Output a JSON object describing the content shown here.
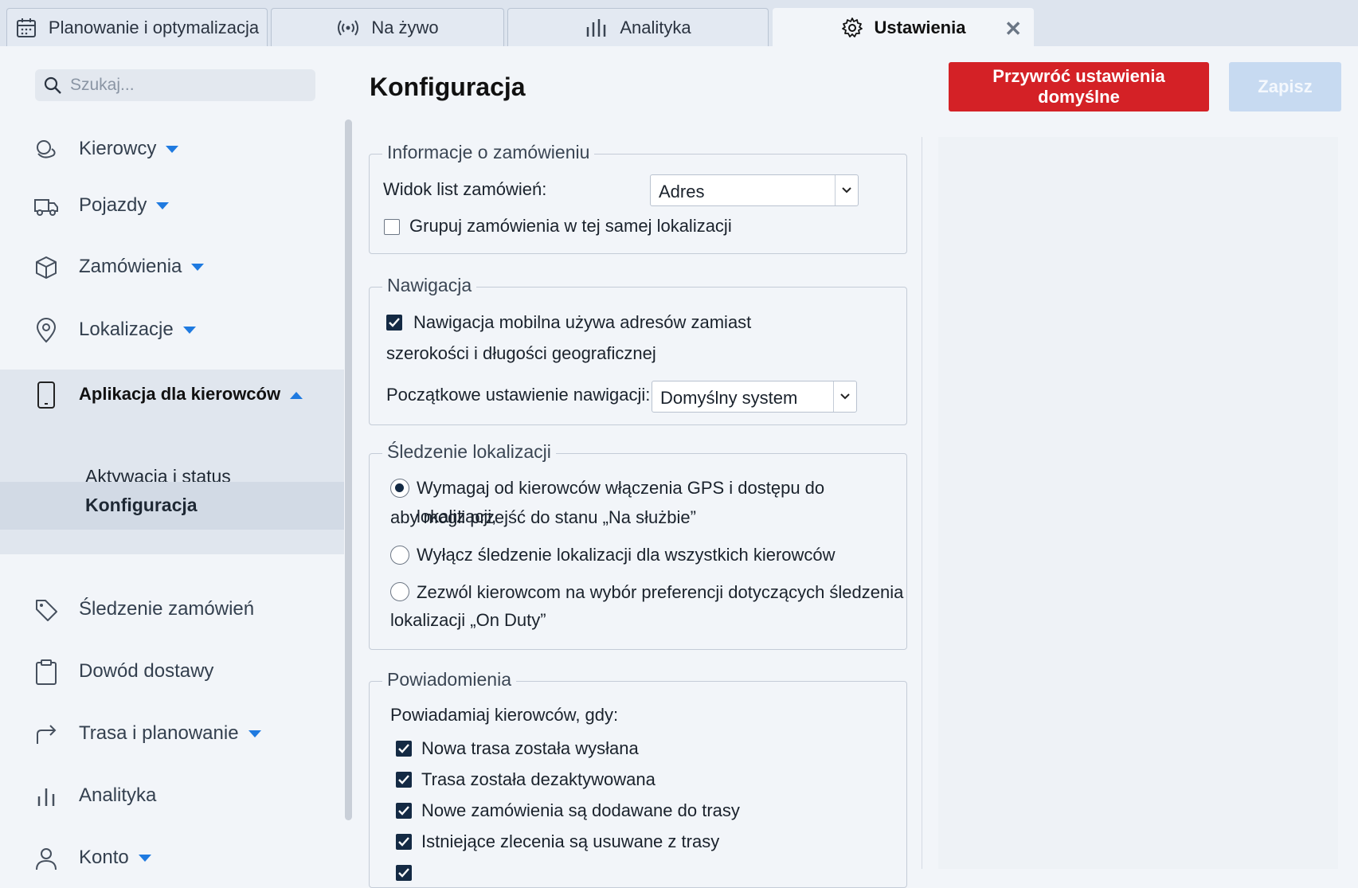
{
  "tabs": [
    {
      "label": "Planowanie i optymalizacja",
      "icon": "calendar-icon"
    },
    {
      "label": "Na żywo",
      "icon": "broadcast-icon"
    },
    {
      "label": "Analityka",
      "icon": "bar-chart-icon"
    },
    {
      "label": "Ustawienia",
      "icon": "gear-icon",
      "active": true
    }
  ],
  "search": {
    "placeholder": "Szukaj..."
  },
  "sidebar": {
    "items": [
      {
        "label": "Kierowcy",
        "icon": "drivers-icon"
      },
      {
        "label": "Pojazdy",
        "icon": "truck-icon"
      },
      {
        "label": "Zamówienia",
        "icon": "package-icon"
      },
      {
        "label": "Lokalizacje",
        "icon": "map-pin-icon"
      },
      {
        "label": "Aplikacja dla kierowców",
        "icon": "phone-icon",
        "expanded": true
      },
      {
        "label": "Śledzenie zamówień",
        "icon": "tag-icon"
      },
      {
        "label": "Dowód dostawy",
        "icon": "clipboard-icon"
      },
      {
        "label": "Trasa i planowanie",
        "icon": "route-arrow-icon"
      },
      {
        "label": "Analityka",
        "icon": "bar-chart-icon"
      },
      {
        "label": "Konto",
        "icon": "user-icon"
      }
    ],
    "subitems": [
      {
        "label": "Aktywacja i status"
      },
      {
        "label": "Konfiguracja",
        "selected": true
      }
    ]
  },
  "header": {
    "title": "Konfiguracja",
    "reset_label": "Przywróć ustawienia domyślne",
    "save_label": "Zapisz"
  },
  "colors": {
    "accent": "#1f7ae0",
    "danger": "#d42126",
    "save_disabled": "#c7daf1",
    "check": "#142a44"
  },
  "order_info": {
    "legend": "Informacje o zamówieniu",
    "list_view_label": "Widok list zamówień:",
    "list_view_value": "Adres",
    "group_label": "Grupuj zamówienia w tej samej lokalizacji",
    "group_checked": false
  },
  "navigation": {
    "legend": "Nawigacja",
    "use_address_label_1": "Nawigacja mobilna używa adresów zamiast",
    "use_address_label_2": "szerokości i długości geograficznej",
    "use_address_checked": true,
    "initial_label": "Początkowe ustawienie nawigacji:",
    "initial_value": "Domyślny system"
  },
  "tracking": {
    "legend": "Śledzenie lokalizacji",
    "options": [
      {
        "line1": "Wymagaj od kierowców włączenia GPS i dostępu do lokalizacji,",
        "line2": "aby mogli przejść do stanu „Na służbie”",
        "selected": true
      },
      {
        "line1": "Wyłącz śledzenie lokalizacji dla wszystkich kierowców",
        "line2": "",
        "selected": false
      },
      {
        "line1": "Zezwól kierowcom na wybór preferencji dotyczących śledzenia",
        "line2": "lokalizacji „On Duty”",
        "selected": false
      }
    ]
  },
  "notifications": {
    "legend": "Powiadomienia",
    "intro": "Powiadamiaj kierowców, gdy:",
    "items": [
      {
        "label": "Nowa trasa została wysłana",
        "checked": true
      },
      {
        "label": "Trasa została dezaktywowana",
        "checked": true
      },
      {
        "label": "Nowe zamówienia są dodawane do trasy",
        "checked": true
      },
      {
        "label": "Istniejące zlecenia są usuwane z trasy",
        "checked": true
      }
    ]
  }
}
